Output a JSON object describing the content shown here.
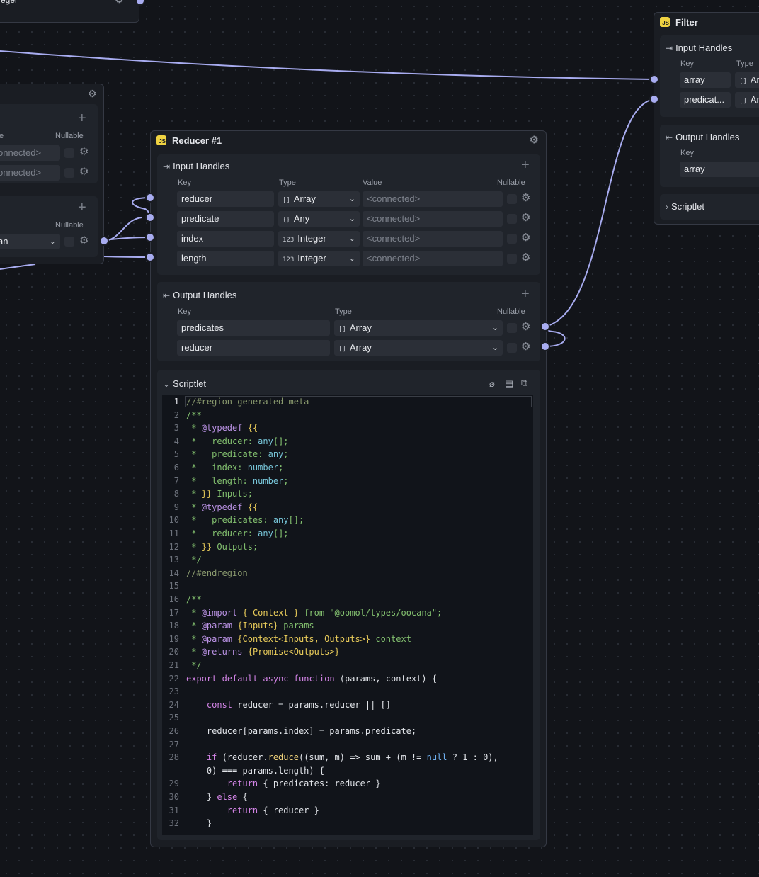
{
  "colors": {
    "canvas": "#121419",
    "node": "#1a1d23",
    "section": "#20242b",
    "field": "#2b2f37",
    "wire": "#a8acf0",
    "js_badge": "#f0d342"
  },
  "left_node_top": {
    "partial_text": "eger"
  },
  "left_node_mid": {
    "col_type": "e",
    "col_nullable": "Nullable",
    "rows": [
      "onnected>",
      "onnected>"
    ],
    "col_nullable2": "Nullable",
    "select_value": "an"
  },
  "reducer": {
    "badge": "JS",
    "title": "Reducer #1",
    "inputs": {
      "title": "Input Handles",
      "cols": {
        "key": "Key",
        "type": "Type",
        "value": "Value",
        "nullable": "Nullable"
      },
      "rows": [
        {
          "key": "reducer",
          "type_icon": "[]",
          "type": "Array",
          "value": "<connected>"
        },
        {
          "key": "predicate",
          "type_icon": "{}",
          "type": "Any",
          "value": "<connected>"
        },
        {
          "key": "index",
          "type_icon": "123",
          "type": "Integer",
          "value": "<connected>"
        },
        {
          "key": "length",
          "type_icon": "123",
          "type": "Integer",
          "value": "<connected>"
        }
      ]
    },
    "outputs": {
      "title": "Output Handles",
      "cols": {
        "key": "Key",
        "type": "Type",
        "nullable": "Nullable"
      },
      "rows": [
        {
          "key": "predicates",
          "type_icon": "[]",
          "type": "Array"
        },
        {
          "key": "reducer",
          "type_icon": "[]",
          "type": "Array"
        }
      ]
    },
    "scriptlet": {
      "title": "Scriptlet"
    }
  },
  "filter": {
    "badge": "JS",
    "title": "Filter",
    "inputs": {
      "title": "Input Handles",
      "cols": {
        "key": "Key",
        "type": "Type"
      },
      "rows": [
        {
          "key": "array",
          "type_icon": "[]",
          "type": "Ar"
        },
        {
          "key": "predicat...",
          "type_icon": "[]",
          "type": "Ar"
        }
      ]
    },
    "outputs": {
      "title": "Output Handles",
      "cols": {
        "key": "Key"
      },
      "rows": [
        {
          "key": "array"
        }
      ]
    },
    "scriptlet": {
      "title": "Scriptlet"
    }
  },
  "code_line_numbers": [
    "1",
    "2",
    "3",
    "4",
    "5",
    "6",
    "7",
    "8",
    "9",
    "10",
    "11",
    "12",
    "13",
    "14",
    "15",
    "16",
    "17",
    "18",
    "19",
    "20",
    "21",
    "22",
    "23",
    "24",
    "25",
    "26",
    "27",
    "28",
    "",
    "29",
    "30",
    "31",
    "32"
  ],
  "code_lines": [
    "//#region generated meta",
    "/**",
    " * @typedef {{",
    " *   reducer: any[];",
    " *   predicate: any;",
    " *   index: number;",
    " *   length: number;",
    " * }} Inputs;",
    " * @typedef {{",
    " *   predicates: any[];",
    " *   reducer: any[];",
    " * }} Outputs;",
    " */",
    "//#endregion",
    "",
    "/**",
    " * @import { Context } from \"@oomol/types/oocana\";",
    " * @param {Inputs} params",
    " * @param {Context<Inputs, Outputs>} context",
    " * @returns {Promise<Outputs>}",
    " */",
    "export default async function (params, context) {",
    "",
    "    const reducer = params.reducer || []",
    "",
    "    reducer[params.index] = params.predicate;",
    "",
    "    if (reducer.reduce((sum, m) => sum + (m != null ? 1 : 0),",
    "    0) === params.length) {",
    "        return { predicates: reducer }",
    "    } else {",
    "        return { reducer }",
    "    }"
  ]
}
